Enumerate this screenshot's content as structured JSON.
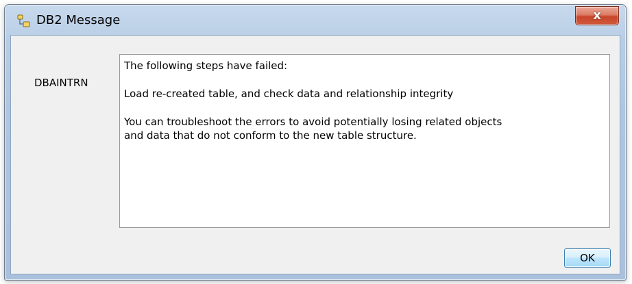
{
  "window": {
    "title": "DB2 Message",
    "title_icon": "db2-message-icon",
    "close_label": "x"
  },
  "dialog": {
    "name_label": "DBAINTRN",
    "message": {
      "line1": "The following steps have failed:",
      "line2": "Load re-created table, and check data and relationship integrity",
      "line3a": "You can troubleshoot the errors to avoid potentially losing related objects",
      "line3b": "and data that do not conform to the new table structure."
    },
    "ok_label": "OK"
  },
  "colors": {
    "titlebar": "#aec6e1",
    "close_button": "#c7452a",
    "ok_button": "#bee6fd",
    "client_bg": "#f0f0f0"
  }
}
